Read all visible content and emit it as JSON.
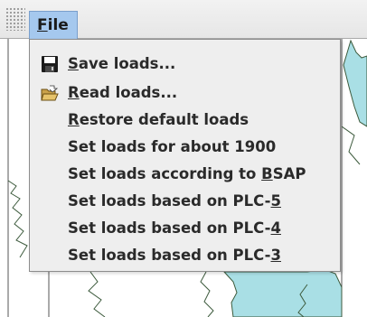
{
  "menubar": {
    "grip_icon": "menubar-grip-icon",
    "file_menu": {
      "mnemonic": "F",
      "rest": "ile"
    }
  },
  "dropdown": {
    "items": [
      {
        "icon": "floppy-disk-icon",
        "mnemonic": "S",
        "rest": "ave loads..."
      },
      {
        "icon": "open-folder-icon",
        "mnemonic": "R",
        "rest": "ead loads..."
      },
      {
        "mnemonic": "R",
        "rest": "estore default loads"
      },
      {
        "text": "Set loads for about 1900"
      },
      {
        "prefix": "Set loads according to ",
        "mnemonic": "B",
        "rest": "SAP"
      },
      {
        "prefix": "Set loads based on PLC-",
        "mnemonic": "5"
      },
      {
        "prefix": "Set loads based on PLC-",
        "mnemonic": "4"
      },
      {
        "prefix": "Set loads based on PLC-",
        "mnemonic": "3"
      }
    ]
  },
  "colors": {
    "menu_highlight": "#a5c8ee",
    "menu_bg": "#eeeeee",
    "water": "#a9dfe5",
    "land": "#ffffff",
    "coastline": "#3c5a3c"
  }
}
